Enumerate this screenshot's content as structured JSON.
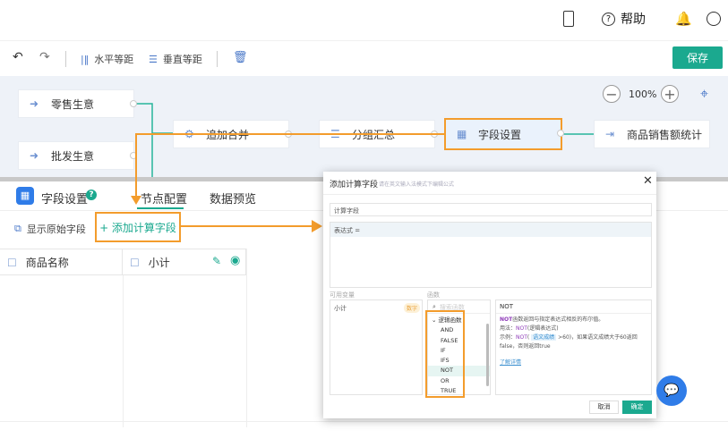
{
  "topbar": {
    "help_label": "帮助",
    "icons": [
      "tablet-icon",
      "help-circle-icon",
      "bell-icon",
      "user-icon"
    ]
  },
  "toolbar": {
    "horizontal_label": "水平等距",
    "vertical_label": "垂直等距",
    "save_label": "保存"
  },
  "canvas": {
    "zoom": "100%",
    "nodes": [
      {
        "label": "零售生意"
      },
      {
        "label": "批发生意"
      },
      {
        "label": "追加合并"
      },
      {
        "label": "分组汇总"
      },
      {
        "label": "字段设置"
      },
      {
        "label": "商品销售额统计"
      }
    ]
  },
  "panel": {
    "title": "字段设置",
    "tabs": [
      "节点配置",
      "数据预览"
    ],
    "show_raw_label": "显示原始字段",
    "add_calc_label": "+ 添加计算字段",
    "columns": [
      "商品名称",
      "小计"
    ]
  },
  "dialog": {
    "title": "添加计算字段",
    "hint": "请在英文输入法模式下编辑公式",
    "name_value": "计算字段",
    "expr_label": "表达式 =",
    "vars_label": "可用变量",
    "funcs_label": "函数",
    "var_name": "小计",
    "var_type": "数字",
    "search_placeholder": "搜索函数",
    "group": "逻辑函数",
    "functions": [
      "AND",
      "FALSE",
      "IF",
      "IFS",
      "NOT",
      "OR",
      "TRUE"
    ],
    "selected": "NOT",
    "desc_title": "NOT",
    "desc_fn": "NOT",
    "desc_text": "函数返回与指定表达式相反的布尔值。",
    "usage_label": "用法：",
    "usage_fn": "NOT",
    "usage_args": "(逻辑表达式)",
    "example_label": "示例：",
    "example_fn": "NOT",
    "example_field": "语文成绩",
    "example_text": ">60)，如果语文成绩大于60返回false，否则返回true",
    "learn_more": "了解详情",
    "cancel": "取消",
    "ok": "确定"
  },
  "colors": {
    "accent": "#1ba98f",
    "highlight": "#f39c2c",
    "canvas_bg": "#eef2f8"
  }
}
